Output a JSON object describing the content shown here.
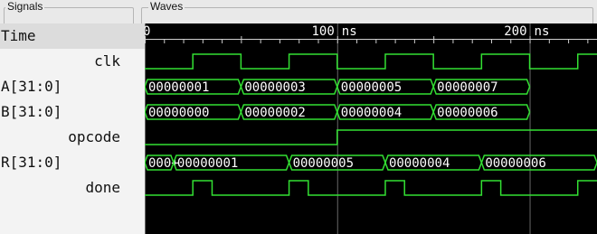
{
  "signals_group": {
    "title": "Signals"
  },
  "waves_group": {
    "title": "Waves"
  },
  "signals": [
    {
      "label": "Time",
      "align": "left",
      "kind": "header"
    },
    {
      "label": "clk",
      "align": "right",
      "kind": "bit"
    },
    {
      "label": "A[31:0]",
      "align": "left",
      "kind": "bus"
    },
    {
      "label": "B[31:0]",
      "align": "left",
      "kind": "bus"
    },
    {
      "label": "opcode",
      "align": "right",
      "kind": "bit"
    },
    {
      "label": "R[31:0]",
      "align": "left",
      "kind": "bus"
    },
    {
      "label": "done",
      "align": "right",
      "kind": "bit"
    }
  ],
  "timeline": {
    "start_label": "0",
    "unit": "ns",
    "view_start": 0,
    "view_end": 235,
    "labels": [
      {
        "time": 0,
        "text": "0"
      },
      {
        "time": 100,
        "text": "100"
      },
      {
        "time": 200,
        "text": "200"
      }
    ],
    "minor_tick_step": 10
  },
  "colors": {
    "wave": "#33e033",
    "text": "#ffffff",
    "background": "#000000",
    "cursor_marker": "#cfcfcf"
  },
  "waves": {
    "clk": {
      "initial": 0,
      "transitions": [
        25,
        50,
        75,
        100,
        125,
        150,
        175,
        200,
        225
      ]
    },
    "opcode": {
      "initial": 0,
      "transitions": [
        100
      ]
    },
    "done": {
      "initial": 0,
      "transitions": [
        25,
        35,
        75,
        85,
        125,
        135,
        175,
        185,
        225
      ]
    },
    "A": [
      {
        "start": 0,
        "end": 50,
        "text": "00000001"
      },
      {
        "start": 50,
        "end": 100,
        "text": "00000003"
      },
      {
        "start": 100,
        "end": 150,
        "text": "00000005"
      },
      {
        "start": 150,
        "end": 200,
        "text": "00000007"
      }
    ],
    "B": [
      {
        "start": 0,
        "end": 50,
        "text": "00000000"
      },
      {
        "start": 50,
        "end": 100,
        "text": "00000002"
      },
      {
        "start": 100,
        "end": 150,
        "text": "00000004"
      },
      {
        "start": 150,
        "end": 200,
        "text": "00000006"
      }
    ],
    "R": [
      {
        "start": 0,
        "end": 15,
        "text": "000+"
      },
      {
        "start": 15,
        "end": 75,
        "text": "00000001"
      },
      {
        "start": 75,
        "end": 125,
        "text": "00000005"
      },
      {
        "start": 125,
        "end": 175,
        "text": "00000004"
      },
      {
        "start": 175,
        "end": 235,
        "text": "00000006"
      }
    ]
  },
  "cursor_times": [
    0,
    100,
    200
  ]
}
